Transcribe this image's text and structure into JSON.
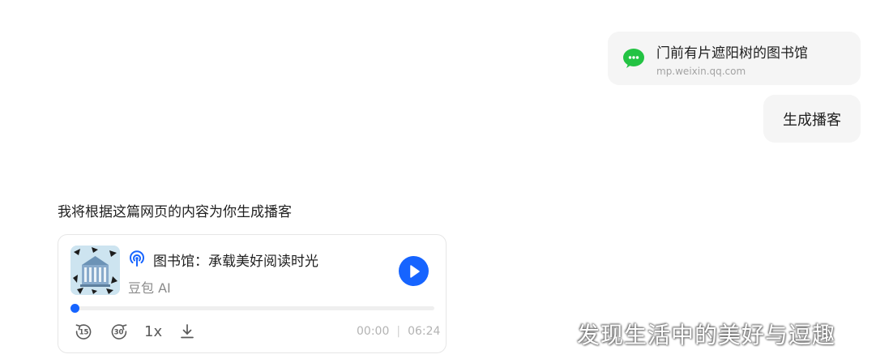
{
  "link_card": {
    "icon": "wechat-icon",
    "title": "门前有片遮阳树的图书馆",
    "url": "mp.weixin.qq.com"
  },
  "user_message": "生成播客",
  "assistant_message": "我将根据这篇网页的内容为你生成播客",
  "podcast": {
    "title": "图书馆：承载美好阅读时光",
    "author": "豆包 AI",
    "progress": 0,
    "speed": "1x",
    "current_time": "00:00",
    "separator": "|",
    "duration": "06:24",
    "controls": {
      "rewind_seconds": "15",
      "forward_seconds": "30"
    },
    "accent": "#1664ff"
  },
  "watermark": "发现生活中的美好与逗趣"
}
